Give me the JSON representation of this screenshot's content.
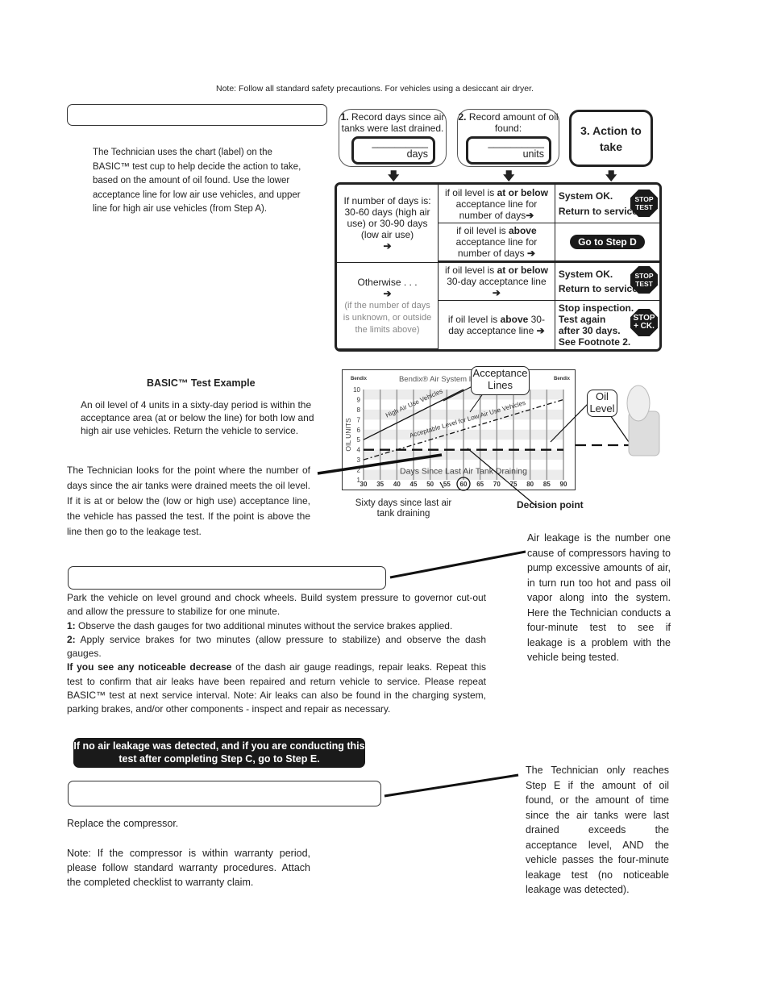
{
  "note_top": "Note: Follow all standard safety precautions.  For vehicles using a desiccant air dryer.",
  "step_c_intro": {
    "text": "The Technician uses the chart (label) on the BASIC™ test cup to help decide the action to take, based on the amount of oil found.  Use the lower acceptance line for low air use vehicles, and upper line for high air use vehicles (from Step A)."
  },
  "steps": {
    "step1": {
      "num": "1.",
      "label": "Record days since air tanks were last drained.",
      "field_value": "__________",
      "field_unit": "days"
    },
    "step2": {
      "num": "2.",
      "label": "Record amount of oil found:",
      "field_value": "__________",
      "field_unit": "units"
    },
    "step3": {
      "label": "3.  Action to take"
    }
  },
  "decision_table": {
    "group1": {
      "condition": "If number of days is: 30-60 days (high air use) or 30-90 days (low air use)",
      "rows": [
        {
          "oil_pre": "if oil level is ",
          "oil_bold": "at or below",
          "oil_post": " acceptance line for number of days",
          "action_line1": "System OK.",
          "action_line2": "Return to service.",
          "badge_line1": "STOP",
          "badge_line2": "TEST"
        },
        {
          "oil_pre": "if oil level is ",
          "oil_bold": "above",
          "oil_post": " acceptance line for number of days",
          "action_button": "Go to Step D"
        }
      ]
    },
    "group2": {
      "condition": "Otherwise . . .",
      "condition_note": "(if the number of days is unknown, or outside the limits above)",
      "rows": [
        {
          "oil_pre": "if oil level is ",
          "oil_bold": "at or below",
          "oil_post": " 30-day acceptance line",
          "action_line1": "System OK.",
          "action_line2": "Return to service.",
          "badge_line1": "STOP",
          "badge_line2": "TEST"
        },
        {
          "oil_pre": "if oil level is ",
          "oil_bold": "above",
          "oil_post": " 30-day acceptance line",
          "action_line1": "Stop inspection.",
          "action_line2": "Test again",
          "action_line3": "after 30 days.",
          "action_line4": "See Footnote 2.",
          "badge_line1": "STOP",
          "badge_line2": "+ CK."
        }
      ]
    },
    "arrow_glyph": "➔"
  },
  "example": {
    "title": "BASIC™ Test Example",
    "text": "An oil level of 4 units in a sixty-day period is within the acceptance area (at or below the line) for both low and high air use vehicles.  Return the vehicle to service.",
    "lookup_text": "The Technician looks for the point where the number of days since the air tanks were drained meets the oil level. If it is at or below the (low or high use) acceptance line, the vehicle has passed the test.  If the point is above the line then go to the leakage test."
  },
  "chart": {
    "title": "Bendix® Air System Insp... (BASIC)",
    "brand": "Bendix",
    "ylabel": "OIL UNITS",
    "xlabel": "Days Since Last Air Tank Draining",
    "high_line_label": "High Air Use Vehicles",
    "low_line_label": "Acceptable Level for Low Air Use Vehicles",
    "callout_acceptance": "Acceptance Lines",
    "callout_oil": "Oil Level",
    "caption_days": "Sixty days since last air tank draining",
    "caption_decision": "Decision point"
  },
  "chart_data": {
    "type": "line",
    "title": "Bendix Air System Inspection Cup (BASIC)",
    "xlabel": "Days Since Last Air Tank Draining",
    "ylabel": "OIL UNITS",
    "x_ticks": [
      30,
      35,
      40,
      45,
      50,
      55,
      60,
      65,
      70,
      75,
      80,
      85,
      90
    ],
    "y_ticks": [
      1,
      2,
      3,
      4,
      5,
      6,
      7,
      8,
      9,
      10
    ],
    "xlim": [
      30,
      90
    ],
    "ylim": [
      1,
      10
    ],
    "series": [
      {
        "name": "High Air Use Vehicles",
        "x": [
          30,
          60
        ],
        "y": [
          5,
          10
        ],
        "style": "solid"
      },
      {
        "name": "Acceptable Level for Low Air Use Vehicles",
        "x": [
          30,
          90
        ],
        "y": [
          3,
          9
        ],
        "style": "dotted"
      },
      {
        "name": "Oil Level",
        "x": [
          30,
          90
        ],
        "y": [
          4,
          4
        ],
        "style": "dashed"
      }
    ],
    "highlight": {
      "x": 60,
      "y": 4,
      "label": "Decision point"
    }
  },
  "leakage": {
    "side_text": "Air leakage is the number one cause of compressors having to pump excessive amounts of air, in turn run too hot and pass oil vapor along into the system. Here the Technician conducts a four-minute test to see if leakage is a problem with the vehicle being tested.",
    "intro": "Park the vehicle on level ground and chock wheels.  Build system pressure to governor cut-out and allow the pressure to stabilize for one minute.",
    "step1_num": "1:",
    "step1": " Observe the dash gauges for two additional minutes without the service brakes applied.",
    "step2_num": "2:",
    "step2": " Apply service brakes for two minutes (allow pressure to stabilize) and observe the dash gauges.",
    "decrease_bold": "If you see any noticeable decrease",
    "decrease_text": " of the dash air gauge readings, repair leaks.  Repeat this test to confirm that air leaks have been repaired and return vehicle to service.  Please repeat BASIC™ test at next service interval.  Note: Air leaks can also be found in the charging system, parking brakes, and/or other components - inspect and repair as necessary."
  },
  "banner": "If no air leakage was detected, and if you are conducting this test after completing Step C, go to Step E.",
  "step_e": {
    "text1": "Replace the compressor.",
    "text2": "Note: If the compressor is within warranty period, please follow standard warranty procedures.  Attach the completed checklist to warranty claim.",
    "side_text": "The Technician only reaches Step E if the amount of oil found, or the amount of time since the air tanks were last drained exceeds the acceptance level, AND the vehicle passes the four-minute leakage test (no noticeable leakage was detected)."
  }
}
